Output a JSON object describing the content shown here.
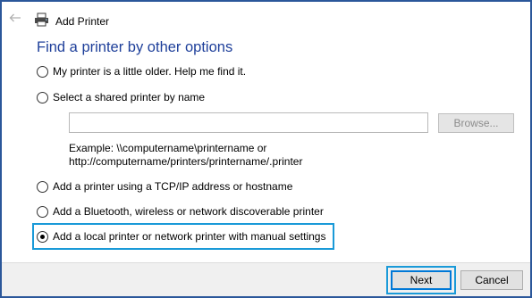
{
  "window": {
    "title": "Add Printer"
  },
  "page": {
    "heading": "Find a printer by other options"
  },
  "options": [
    {
      "label": "My printer is a little older. Help me find it.",
      "selected": false
    },
    {
      "label": "Select a shared printer by name",
      "selected": false
    },
    {
      "label": "Add a printer using a TCP/IP address or hostname",
      "selected": false
    },
    {
      "label": "Add a Bluetooth, wireless or network discoverable printer",
      "selected": false
    },
    {
      "label": "Add a local printer or network printer with manual settings",
      "selected": true
    }
  ],
  "shared_printer": {
    "value": "",
    "browse_label": "Browse...",
    "example_line1": "Example: \\\\computername\\printername or",
    "example_line2": "http://computername/printers/printername/.printer"
  },
  "footer": {
    "next_label": "Next",
    "cancel_label": "Cancel"
  },
  "colors": {
    "heading": "#1e3f9a",
    "highlight": "#1a9ad8",
    "window_border": "#2b579a",
    "footer_bg": "#f0f0f0"
  },
  "icons": {
    "back": "back-arrow-icon",
    "app": "printer-icon"
  }
}
